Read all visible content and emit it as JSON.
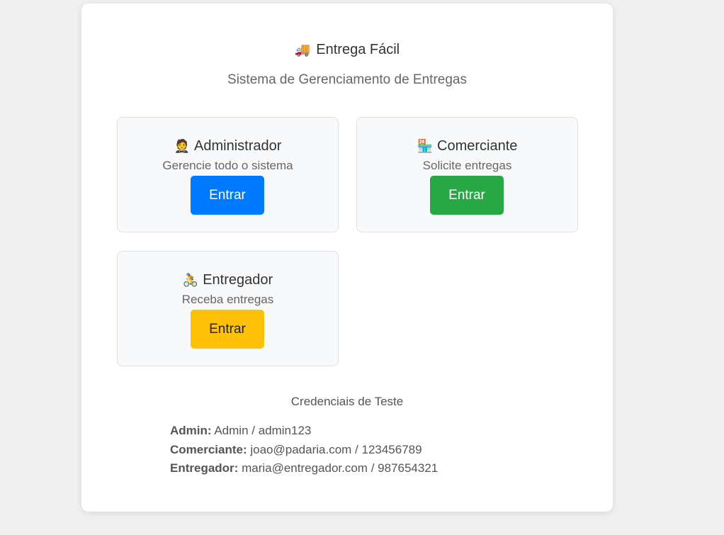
{
  "app": {
    "emoji": "🚚",
    "title": "Entrega Fácil",
    "subtitle": "Sistema de Gerenciamento de Entregas"
  },
  "roles": [
    {
      "emoji": "🤵",
      "title": "Administrador",
      "description": "Gerencie todo o sistema",
      "button_label": "Entrar",
      "button_color": "#007bff"
    },
    {
      "emoji": "🏪",
      "title": "Comerciante",
      "description": "Solicite entregas",
      "button_label": "Entrar",
      "button_color": "#28a745"
    },
    {
      "emoji": "🚴",
      "title": "Entregador",
      "description": "Receba entregas",
      "button_label": "Entrar",
      "button_color": "#ffc107"
    }
  ],
  "credentials": {
    "title": "Credenciais de Teste",
    "items": [
      {
        "label": "Admin:",
        "value": "Admin / admin123"
      },
      {
        "label": "Comerciante:",
        "value": "joao@padaria.com / 123456789"
      },
      {
        "label": "Entregador:",
        "value": "maria@entregador.com / 987654321"
      }
    ]
  }
}
